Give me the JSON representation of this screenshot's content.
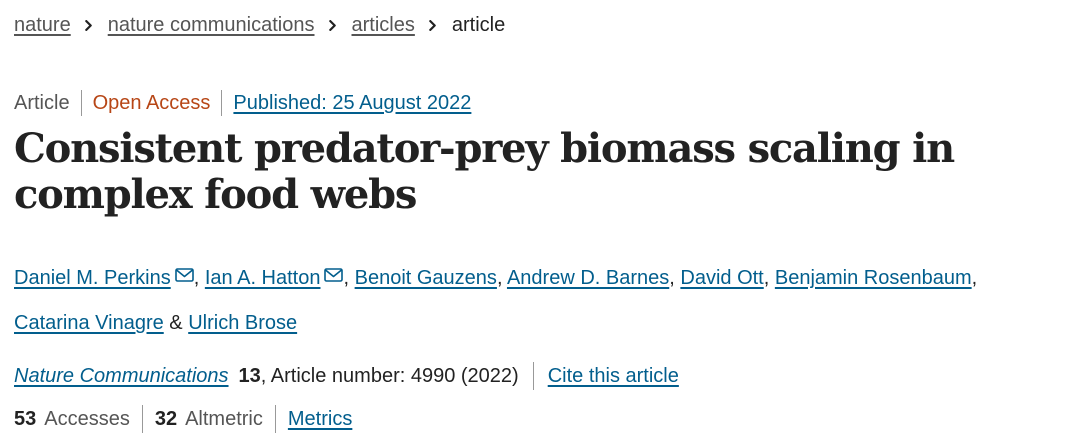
{
  "breadcrumb": {
    "items": [
      "nature",
      "nature communications",
      "articles"
    ],
    "current": "article"
  },
  "meta": {
    "type": "Article",
    "access": "Open Access",
    "published": "Published: 25 August 2022"
  },
  "title": "Consistent predator-prey biomass scaling in complex food webs",
  "authors": {
    "a1": "Daniel M. Perkins",
    "a2": "Ian A. Hatton",
    "a3": "Benoit Gauzens",
    "a4": "Andrew D. Barnes",
    "a5": "David Ott",
    "a6": "Benjamin Rosenbaum",
    "a7": "Catarina Vinagre",
    "a8": "Ulrich Brose",
    "comma": ",",
    "amp": "&"
  },
  "citation": {
    "journal": "Nature Communications",
    "volume": "13",
    "details": ", Article number: 4990 (2022)",
    "cite_label": "Cite this article"
  },
  "metrics": {
    "accesses_count": "53",
    "accesses_label": "Accesses",
    "altmetric_count": "32",
    "altmetric_label": "Altmetric",
    "metrics_link": "Metrics"
  },
  "colors": {
    "link": "#025e8d",
    "open_access": "#b74616",
    "text": "#222222",
    "muted": "#555555"
  },
  "icons": {
    "breadcrumb_separator": "chevron-right-icon",
    "author_contact": "envelope-icon"
  }
}
